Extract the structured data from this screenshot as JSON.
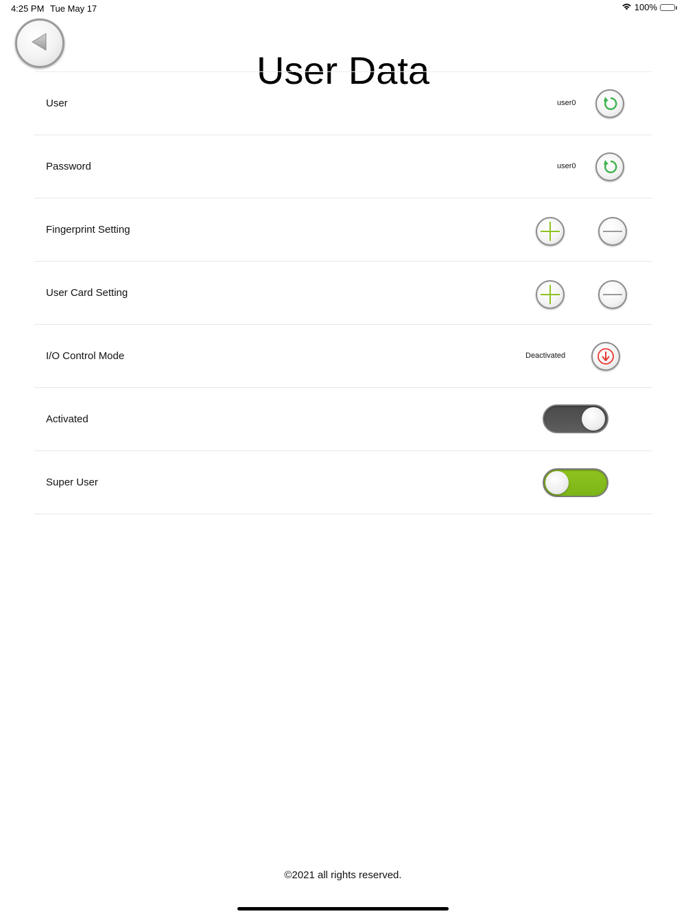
{
  "status_bar": {
    "time": "4:25 PM",
    "date": "Tue May 17",
    "battery": "100%"
  },
  "header": {
    "title": "User Data"
  },
  "rows": {
    "user": {
      "label": "User",
      "value": "user0"
    },
    "password": {
      "label": "Password",
      "value": "user0"
    },
    "fingerprint": {
      "label": "Fingerprint Setting"
    },
    "user_card": {
      "label": "User Card Setting"
    },
    "io_control": {
      "label": "I/O Control Mode",
      "value": "Deactivated"
    },
    "activated": {
      "label": "Activated",
      "state": "on"
    },
    "super_user": {
      "label": "Super User",
      "state": "off"
    }
  },
  "colors": {
    "accent_green": "#8fc31f",
    "refresh_green": "#3fb34f",
    "alert_red": "#e8392f",
    "toggle_dark": "#555555"
  },
  "icons": {
    "back": "back-arrow-icon",
    "refresh": "refresh-icon",
    "add": "plus-icon",
    "remove": "minus-icon",
    "download": "down-arrow-icon",
    "wifi": "wifi-icon",
    "battery": "battery-icon"
  },
  "footer": {
    "copyright": "©2021 all rights reserved."
  }
}
